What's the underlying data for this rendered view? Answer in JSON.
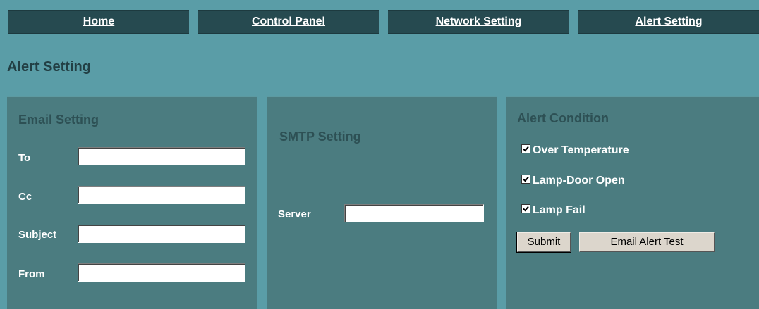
{
  "nav": {
    "home": "Home",
    "control_panel": "Control Panel",
    "network_setting": "Network Setting",
    "alert_setting": "Alert Setting"
  },
  "page_title": "Alert Setting",
  "email_setting": {
    "title": "Email Setting",
    "fields": {
      "to": {
        "label": "To",
        "value": ""
      },
      "cc": {
        "label": "Cc",
        "value": ""
      },
      "subject": {
        "label": "Subject",
        "value": ""
      },
      "from": {
        "label": "From",
        "value": ""
      }
    }
  },
  "smtp_setting": {
    "title": "SMTP Setting",
    "server": {
      "label": "Server",
      "value": ""
    }
  },
  "alert_condition": {
    "title": "Alert Condition",
    "conditions": [
      {
        "label": "Over Temperature",
        "checked": true
      },
      {
        "label": "Lamp-Door Open",
        "checked": true
      },
      {
        "label": "Lamp Fail",
        "checked": true
      }
    ],
    "submit_label": "Submit",
    "test_label": "Email Alert Test"
  },
  "colors": {
    "background": "#5a9da7",
    "nav_tab": "#264a50",
    "panel": "#4b7c80",
    "title_text": "#223f44"
  }
}
